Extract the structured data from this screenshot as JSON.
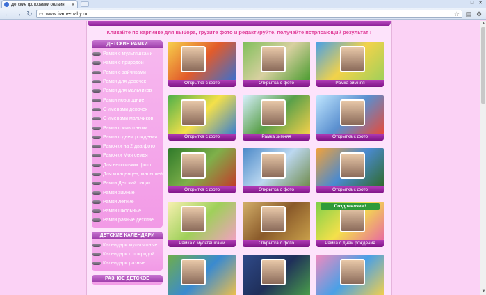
{
  "browser": {
    "tab_title": "Детские фоторамки онлайн",
    "url": "www.frame-baby.ru"
  },
  "slogan": "Кликайте по картинке для выбора, грузите фото и редактируйте, получайте потрясающий результат !",
  "sidebar": {
    "frames_header": "ДЕТСКИЕ РАМКИ",
    "frames": [
      "Рамки с мультяшками",
      "Рамки с природой",
      "Рамки с зайчиками",
      "Рамки для девочек",
      "Рамки для мальчиков",
      "Рамки новогодние",
      "С именами девочек",
      "С именами мальчиков",
      "Рамки с животными",
      "Рамки с днем рождения",
      "Рамочки на 2 два фото",
      "Рамочки Моя семья",
      "Для нескольких фото",
      "Для младенцев, малышей",
      "Рамки Детский садик",
      "Рамки зимние",
      "Рамки летние",
      "Рамки школьные",
      "Рамки разные детские"
    ],
    "calendars_header": "ДЕТСКИЕ КАЛЕНДАРИ",
    "calendars": [
      "Календари мультяшные",
      "Календари с природой",
      "Календари разные"
    ],
    "misc_header": "РАЗНОЕ ДЕТСКОЕ"
  },
  "grid": {
    "captions": [
      "Открытка с фото",
      "Открытка с фото",
      "Рамка зимняя",
      "Открытка с фото",
      "Рамка зимняя",
      "Открытка с фото",
      "Открытка с фото",
      "Открытка с фото",
      "Открытка с фото",
      "Рамка с мультяшками",
      "Открытка с фото",
      "Рамка с днем рождения"
    ],
    "banner_text": "Поздравляем!"
  },
  "colors": {
    "page_bg": "#fbd2f5",
    "caption_bg": "#8a1c95",
    "slogan": "#e0409a",
    "menu_bg": "#f29ae6"
  }
}
